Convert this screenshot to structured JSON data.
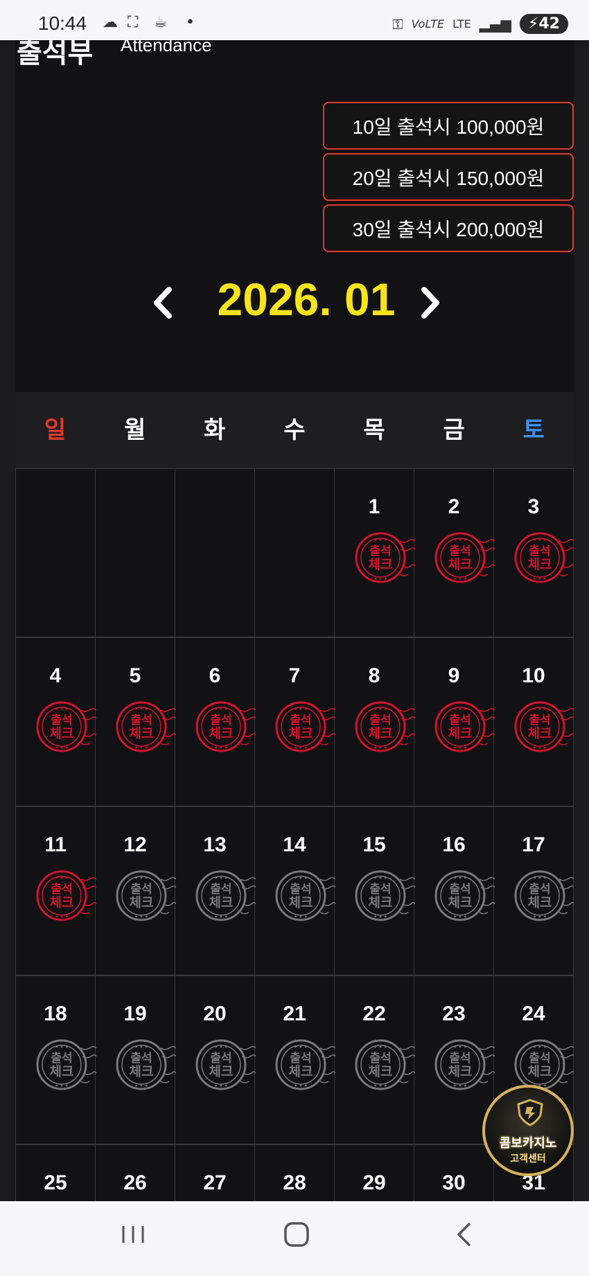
{
  "status_bar": {
    "time": "10:44",
    "signal_text": "LTE",
    "battery": "42"
  },
  "page": {
    "title_ko": "출석부",
    "title_en": "Attendance"
  },
  "rewards": [
    "10일 출석시 100,000원",
    "20일 출석시 150,000원",
    "30일 출석시 200,000원"
  ],
  "calendar": {
    "month_label": "2026. 01",
    "weekdays": [
      "일",
      "월",
      "화",
      "수",
      "목",
      "금",
      "토"
    ],
    "weeks": [
      [
        "",
        "",
        "",
        "",
        "1",
        "2",
        "3"
      ],
      [
        "4",
        "5",
        "6",
        "7",
        "8",
        "9",
        "10"
      ],
      [
        "11",
        "12",
        "13",
        "14",
        "15",
        "16",
        "17"
      ],
      [
        "18",
        "19",
        "20",
        "21",
        "22",
        "23",
        "24"
      ],
      [
        "25",
        "26",
        "27",
        "28",
        "29",
        "30",
        "31"
      ]
    ],
    "checked_days": [
      1,
      2,
      3,
      4,
      5,
      6,
      7,
      8,
      9,
      10,
      11
    ],
    "stamp_text_top": "출석",
    "stamp_text_bottom": "체크",
    "colors": {
      "checked": "#d4122b",
      "unchecked": "#7a7a7a",
      "month": "#f7e51a",
      "sunday": "#e23a2a",
      "saturday": "#3b91f3",
      "reward_border": "#e03a2b"
    }
  },
  "support_badge": {
    "name": "콤보카지노",
    "sub": "고객센터"
  },
  "icons": {
    "prev": "chevron-left-icon",
    "next": "chevron-right-icon",
    "nav_recent": "recent-apps-icon",
    "nav_home": "home-icon",
    "nav_back": "back-icon"
  }
}
